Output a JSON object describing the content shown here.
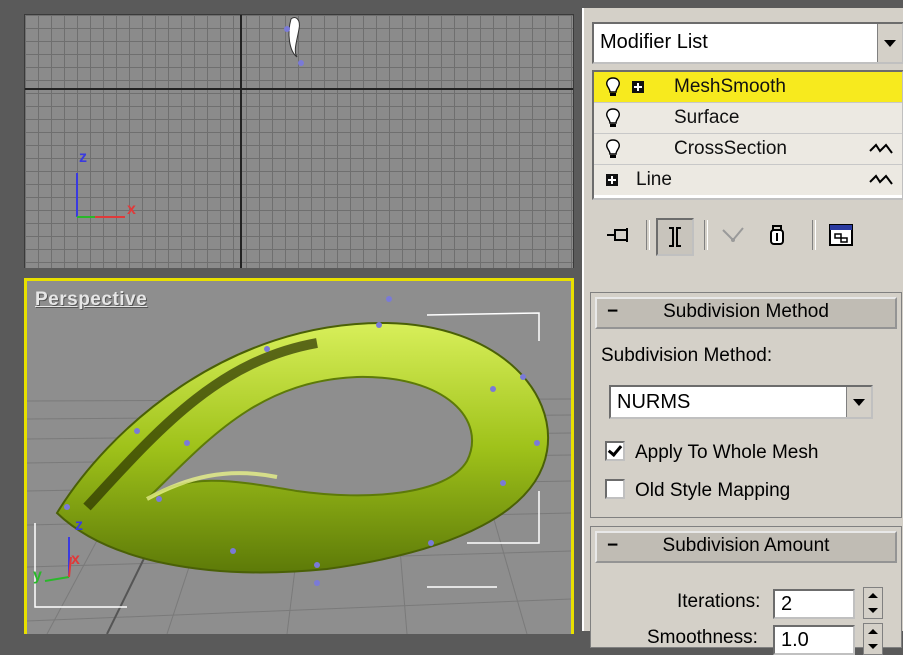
{
  "viewports": {
    "top": {
      "axis_z": "z",
      "axis_x": "x"
    },
    "perspective": {
      "label": "Perspective",
      "axis_z": "z",
      "axis_x": "x",
      "axis_y": "y"
    }
  },
  "modifier_panel": {
    "modifier_list_label": "Modifier List",
    "stack": [
      {
        "label": "MeshSmooth",
        "selected": true
      },
      {
        "label": "Surface"
      },
      {
        "label": "CrossSection"
      },
      {
        "label": "Line"
      }
    ]
  },
  "subdivision_method_rollout": {
    "title": "Subdivision Method",
    "collapse_symbol": "−",
    "field_label": "Subdivision Method:",
    "method_value": "NURMS",
    "apply_whole_mesh_label": "Apply To Whole Mesh",
    "apply_whole_mesh_checked": true,
    "old_style_mapping_label": "Old Style Mapping",
    "old_style_mapping_checked": false
  },
  "subdivision_amount_rollout": {
    "title": "Subdivision Amount",
    "collapse_symbol": "−",
    "iterations_label": "Iterations:",
    "iterations_value": "2",
    "smoothness_label": "Smoothness:",
    "smoothness_value": "1.0"
  },
  "colors": {
    "selection_highlight": "#f7ea1e",
    "active_viewport_border": "#e8e000",
    "mesh_color": "#9fc21a",
    "panel_bg": "#d4d0c8"
  },
  "icons": [
    "lightbulb-icon",
    "plus-box-icon",
    "pin-stack-icon",
    "show-end-result-icon",
    "make-unique-icon",
    "remove-modifier-icon",
    "configure-sets-icon"
  ]
}
